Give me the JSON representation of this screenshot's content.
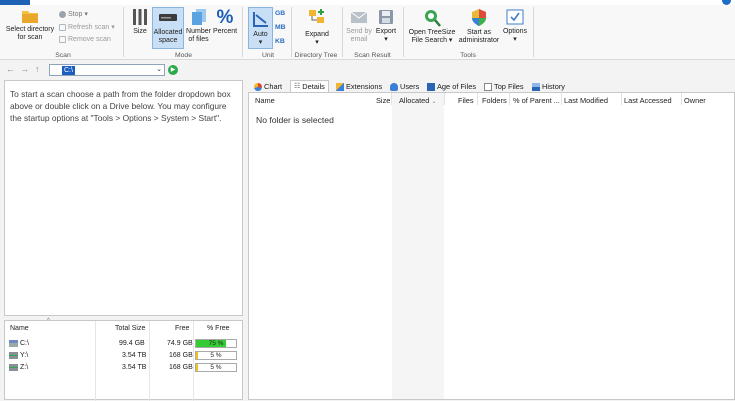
{
  "ribbon": {
    "scan_group": {
      "select_dir_label_1": "Select directory",
      "select_dir_label_2": "for scan",
      "stop_label": "Stop",
      "refresh_label": "Refresh scan",
      "remove_label": "Remove scan",
      "group_label": "Scan"
    },
    "mode_group": {
      "size_label": "Size",
      "allocated_label_1": "Allocated",
      "allocated_label_2": "space",
      "number_label_1": "Number",
      "number_label_2": "of files",
      "percent_label": "Percent",
      "group_label": "Mode"
    },
    "unit_group": {
      "auto_label": "Auto",
      "gb": "GB",
      "mb": "MB",
      "kb": "KB",
      "group_label": "Unit"
    },
    "tree_group": {
      "expand_label": "Expand",
      "group_label": "Directory Tree"
    },
    "result_group": {
      "send_label_1": "Send by",
      "send_label_2": "email",
      "export_label": "Export",
      "group_label": "Scan Result"
    },
    "tools_group": {
      "open_label_1": "Open TreeSize",
      "open_label_2": "File Search",
      "admin_label_1": "Start as",
      "admin_label_2": "administrator",
      "options_label": "Options",
      "group_label": "Tools"
    }
  },
  "address": {
    "path_value": "C:\\"
  },
  "info_text": "To start a scan choose a path from the folder dropdown box above or double click on a Drive below. You may configure the startup options at \"Tools > Options > System > Start\".",
  "drives": {
    "headers": {
      "name": "Name",
      "total": "Total Size",
      "free": "Free",
      "pct": "% Free"
    },
    "rows": [
      {
        "name": "C:\\",
        "total": "99.4 GB",
        "free": "74.9 GB",
        "pct_text": "75 %",
        "pct": 75,
        "color": "#33cc33"
      },
      {
        "name": "Y:\\",
        "total": "3.54 TB",
        "free": "168 GB",
        "pct_text": "5 %",
        "pct": 5,
        "color": "#f2c21b"
      },
      {
        "name": "Z:\\",
        "total": "3.54 TB",
        "free": "168 GB",
        "pct_text": "5 %",
        "pct": 5,
        "color": "#f2c21b"
      }
    ]
  },
  "tabs": {
    "chart": "Chart",
    "details": "Details",
    "extensions": "Extensions",
    "users": "Users",
    "age": "Age of Files",
    "top": "Top Files",
    "history": "History"
  },
  "details": {
    "columns": {
      "name": "Name",
      "size": "Size",
      "allocated": "Allocated",
      "files": "Files",
      "folders": "Folders",
      "pct_parent": "% of Parent ...",
      "last_modified": "Last Modified",
      "last_accessed": "Last Accessed",
      "owner": "Owner"
    },
    "empty_message": "No folder is selected"
  }
}
